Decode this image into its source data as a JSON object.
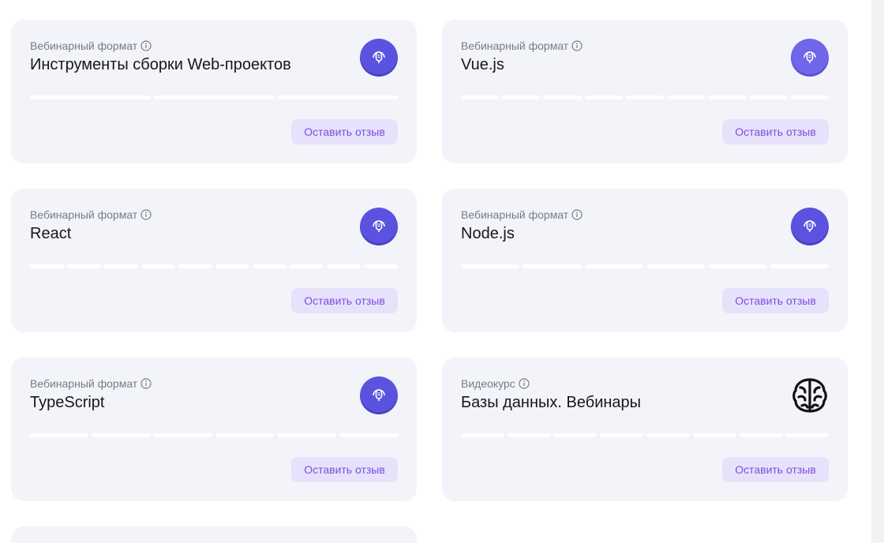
{
  "cards": [
    {
      "type": "Вебинарный формат",
      "title": "Инструменты сборки Web-проектов",
      "icon": "webinar-mic-icon",
      "segments": 3,
      "button": "Оставить отзыв"
    },
    {
      "type": "Вебинарный формат",
      "title": "Vue.js",
      "icon": "webinar-mic-icon",
      "segments": 9,
      "button": "Оставить отзыв"
    },
    {
      "type": "Вебинарный формат",
      "title": "React",
      "icon": "webinar-mic-icon",
      "segments": 10,
      "button": "Оставить отзыв"
    },
    {
      "type": "Вебинарный формат",
      "title": "Node.js",
      "icon": "webinar-mic-icon",
      "segments": 6,
      "button": "Оставить отзыв"
    },
    {
      "type": "Вебинарный формат",
      "title": "TypeScript",
      "icon": "webinar-mic-icon",
      "segments": 6,
      "button": "Оставить отзыв"
    },
    {
      "type": "Видеокурс",
      "title": "Базы данных. Вебинары",
      "icon": "brain-icon",
      "segments": 8,
      "button": "Оставить отзыв"
    }
  ],
  "colors": {
    "card_bg": "#f3f4f9",
    "accent": "#5b53e0",
    "button_bg": "#e6e2fb",
    "button_text": "#7a4fe0"
  }
}
